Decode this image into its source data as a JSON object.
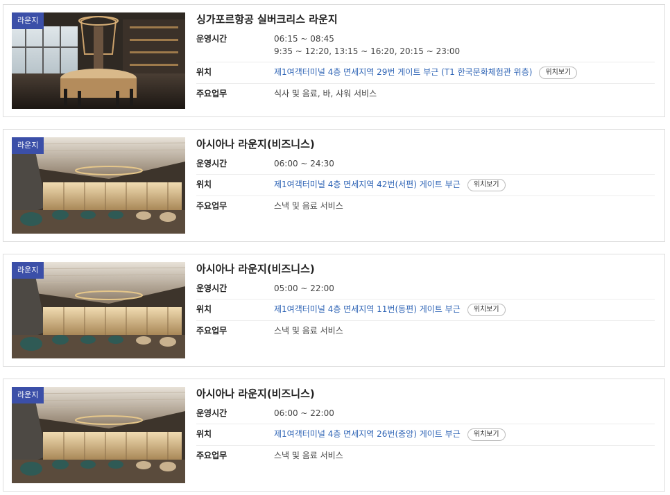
{
  "lounges": [
    {
      "badge": "라운지",
      "name": "싱가포르항공 실버크리스 라운지",
      "labels": {
        "hours": "운영시간",
        "location": "위치",
        "services": "주요업무"
      },
      "hours_line1": "06:15 ~ 08:45",
      "hours_line2": "9:35 ~ 12:20, 13:15 ~ 16:20, 20:15 ~ 23:00",
      "location": "제1여객터미널 4층 면세지역 29번 게이트 부근 (T1 한국문화체험관 위층)",
      "location_button": "위치보기",
      "services": "식사 및 음료, 바, 샤워 서비스"
    },
    {
      "badge": "라운지",
      "name": "아시아나 라운지(비즈니스)",
      "labels": {
        "hours": "운영시간",
        "location": "위치",
        "services": "주요업무"
      },
      "hours_line1": "06:00 ~ 24:30",
      "location": "제1여객터미널 4층 면세지역 42번(서편) 게이트 부근",
      "location_button": "위치보기",
      "services": "스낵 및 음료 서비스"
    },
    {
      "badge": "라운지",
      "name": "아시아나 라운지(비즈니스)",
      "labels": {
        "hours": "운영시간",
        "location": "위치",
        "services": "주요업무"
      },
      "hours_line1": "05:00 ~ 22:00",
      "location": "제1여객터미널 4층 면세지역 11번(동편) 게이트 부근",
      "location_button": "위치보기",
      "services": "스낵 및 음료 서비스"
    },
    {
      "badge": "라운지",
      "name": "아시아나 라운지(비즈니스)",
      "labels": {
        "hours": "운영시간",
        "location": "위치",
        "services": "주요업무"
      },
      "hours_line1": "06:00 ~ 22:00",
      "location": "제1여객터미널 4층 면세지역 26번(중앙) 게이트 부근",
      "location_button": "위치보기",
      "services": "스낵 및 음료 서비스"
    }
  ]
}
